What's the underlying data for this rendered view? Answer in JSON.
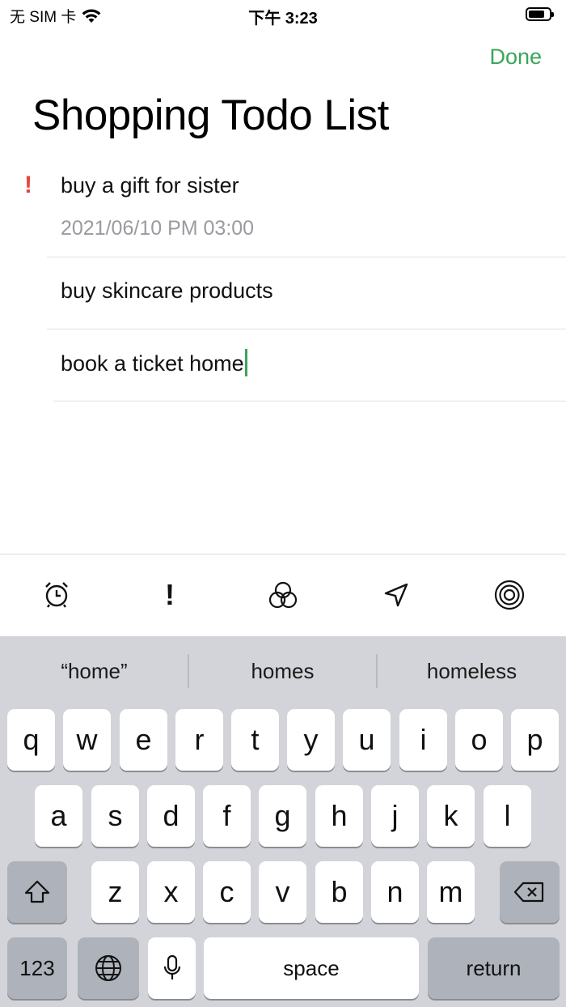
{
  "status_bar": {
    "carrier": "无 SIM 卡",
    "time": "下午 3:23",
    "battery_level": 0.8
  },
  "header": {
    "done_label": "Done",
    "title": "Shopping Todo List"
  },
  "todos": [
    {
      "title": "buy a gift for sister",
      "date": "2021/06/10 PM 03:00",
      "priority": "!",
      "flagged": true
    },
    {
      "title": "buy skincare products"
    },
    {
      "title": "book a ticket home",
      "editing": true
    }
  ],
  "toolbar": {
    "icons": [
      "alarm-icon",
      "priority-icon",
      "circles-icon",
      "location-arrow-icon",
      "target-icon"
    ],
    "priority_glyph": "!"
  },
  "keyboard": {
    "suggestions": [
      "“home”",
      "homes",
      "homeless"
    ],
    "row1": [
      "q",
      "w",
      "e",
      "r",
      "t",
      "y",
      "u",
      "i",
      "o",
      "p"
    ],
    "row2": [
      "a",
      "s",
      "d",
      "f",
      "g",
      "h",
      "j",
      "k",
      "l"
    ],
    "row3": [
      "z",
      "x",
      "c",
      "v",
      "b",
      "n",
      "m"
    ],
    "numbers_label": "123",
    "space_label": "space",
    "return_label": "return"
  },
  "colors": {
    "accent": "#3aa55a",
    "priority": "#e5463a",
    "keyboard_bg": "#d3d4d9"
  }
}
